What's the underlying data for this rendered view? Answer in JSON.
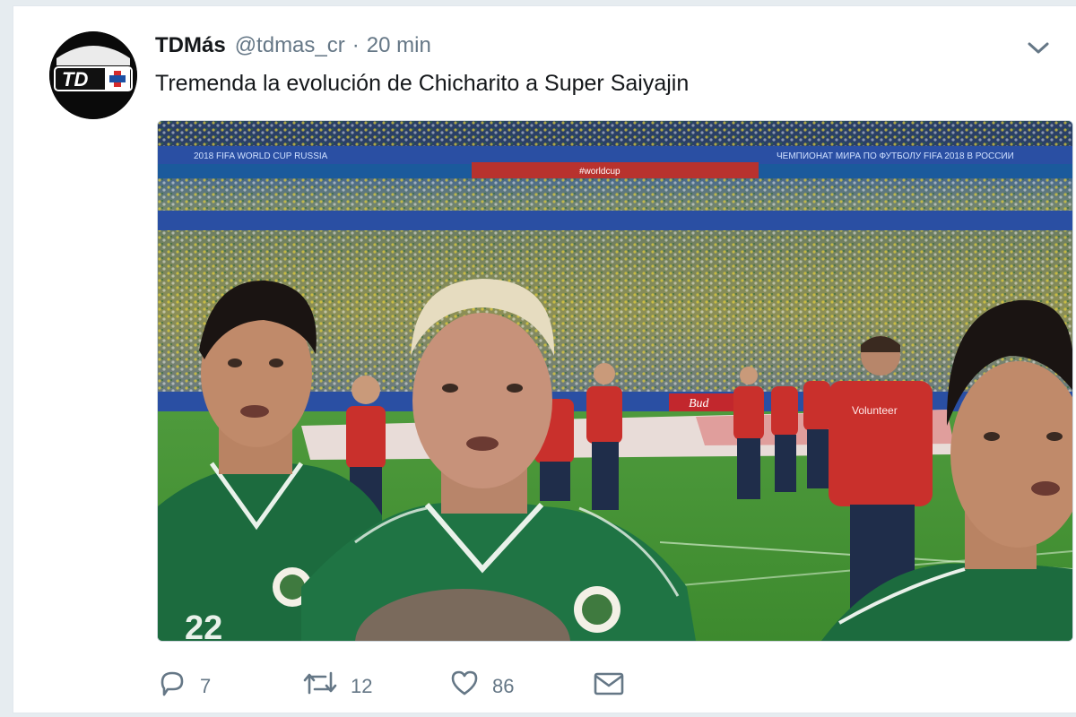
{
  "tweet": {
    "display_name": "TDMás",
    "handle": "@tdmas_cr",
    "separator": "·",
    "time_ago": "20 min",
    "text": "Tremenda la evolución de Chicharito a Super Saiyajin",
    "avatar_label": "TD+",
    "avatar_icon": "td-mas-logo",
    "menu_icon": "chevron-down-icon"
  },
  "media": {
    "description_icon": "photo",
    "banner_text_left": "2018 FIFA WORLD CUP RUSSIA",
    "banner_text_right": "ЧЕМПИОНАТ МИРА ПО ФУТБОЛУ FIFA 2018 В РОССИИ",
    "banner_text_center": "#worldcup",
    "board_text": "Bud",
    "vest_text": "Volunteer"
  },
  "actions": {
    "reply_count": "7",
    "retweet_count": "12",
    "like_count": "86",
    "reply_icon": "reply-icon",
    "retweet_icon": "retweet-icon",
    "like_icon": "heart-icon",
    "dm_icon": "envelope-icon"
  },
  "colors": {
    "name": "#14171a",
    "muted": "#657786",
    "jersey_green": "#1c6b3e",
    "stadium_blue": "#2a4fa3",
    "vest_red": "#c9302c"
  }
}
